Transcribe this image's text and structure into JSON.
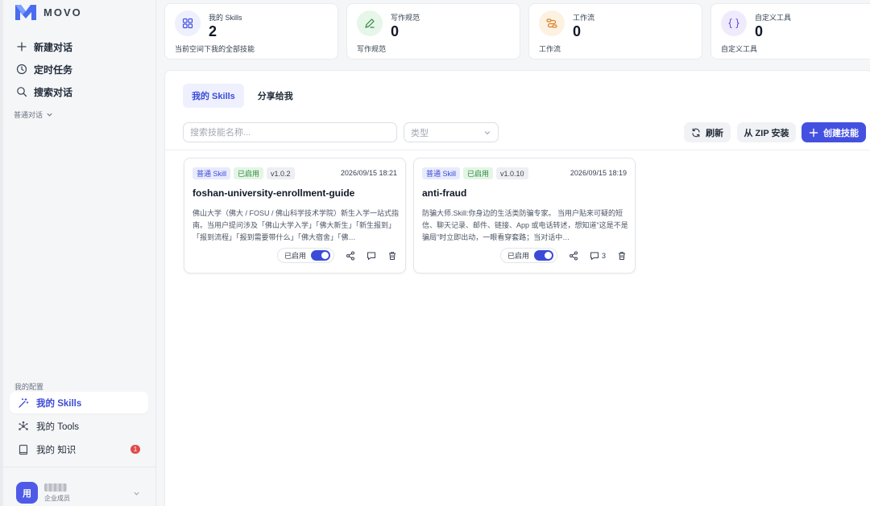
{
  "app": {
    "name": "MOVO"
  },
  "sidebar": {
    "nav": [
      {
        "label": "新建对话",
        "icon": "plus-icon"
      },
      {
        "label": "定时任务",
        "icon": "clock-icon"
      },
      {
        "label": "搜索对话",
        "icon": "search-icon"
      }
    ],
    "group_label": "普通对话",
    "config_label": "我的配置",
    "config_items": [
      {
        "label": "我的 Skills",
        "icon": "magic-wand-icon",
        "active": true
      },
      {
        "label": "我的 Tools",
        "icon": "network-icon",
        "active": false
      },
      {
        "label": "我的 知识",
        "icon": "book-icon",
        "active": false,
        "badge": "1"
      }
    ],
    "user": {
      "avatar": "用",
      "name": "██",
      "role": "企业成员"
    }
  },
  "stats": [
    {
      "label": "我的 Skills",
      "value": "2",
      "desc": "当前空间下我的全部技能",
      "icon": "grid-icon",
      "color": "#4451e0",
      "bg": "#eef0fd"
    },
    {
      "label": "写作规范",
      "value": "0",
      "desc": "写作规范",
      "icon": "pen-icon",
      "color": "#2e8a3e",
      "bg": "#e6f6e9"
    },
    {
      "label": "工作流",
      "value": "0",
      "desc": "工作流",
      "icon": "workflow-icon",
      "color": "#d9822b",
      "bg": "#fdf1e2"
    },
    {
      "label": "自定义工具",
      "value": "0",
      "desc": "自定义工具",
      "icon": "braces-icon",
      "color": "#6b4fd8",
      "bg": "#efebfc"
    }
  ],
  "tabs": [
    {
      "label": "我的 Skills",
      "active": true
    },
    {
      "label": "分享给我",
      "active": false
    }
  ],
  "toolbar": {
    "search_placeholder": "搜索技能名称...",
    "type_placeholder": "类型",
    "refresh_label": "刷新",
    "zip_label": "从 ZIP 安装",
    "create_label": "创建技能"
  },
  "cards": [
    {
      "type": "普通 Skill",
      "status": "已启用",
      "version": "v1.0.2",
      "date": "2026/09/15 18:21",
      "title": "foshan-university-enrollment-guide",
      "desc": "佛山大学（佛大 / FOSU / 佛山科学技术学院）新生入学一站式指南。当用户提问涉及「佛山大学入学」「佛大新生」「新生报到」「报到流程」「报到需要带什么」「佛大宿舍」「佛…",
      "toggle_label": "已启用",
      "enabled": true,
      "comment_count": ""
    },
    {
      "type": "普通 Skill",
      "status": "已启用",
      "version": "v1.0.10",
      "date": "2026/09/15 18:19",
      "title": "anti-fraud",
      "desc": "防骗大师.Skill:你身边的生活类防骗专家。 当用户贴来可疑的短信、聊天记录、邮件、链接、App 或电话转述，想知道\"这是不是骗局\"时立即出动，一眼看穿套路；当对话中…",
      "toggle_label": "已启用",
      "enabled": true,
      "comment_count": "3"
    }
  ]
}
